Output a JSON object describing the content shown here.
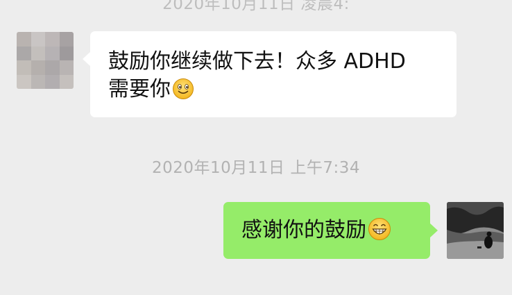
{
  "chat": {
    "top_timestamp": "2020年10月11日 凌晨4:",
    "incoming": {
      "line1": "鼓励你继续做下去！众多 ADHD",
      "line2": "需要你",
      "emoji": "smile-emoji"
    },
    "middle_timestamp": "2020年10月11日 上午7:34",
    "outgoing": {
      "text": "感谢你的鼓励",
      "emoji": "grin-emoji"
    }
  },
  "colors": {
    "background": "#ededed",
    "incoming_bubble": "#ffffff",
    "outgoing_bubble": "#95ec69",
    "timestamp": "#b2b2b2"
  }
}
